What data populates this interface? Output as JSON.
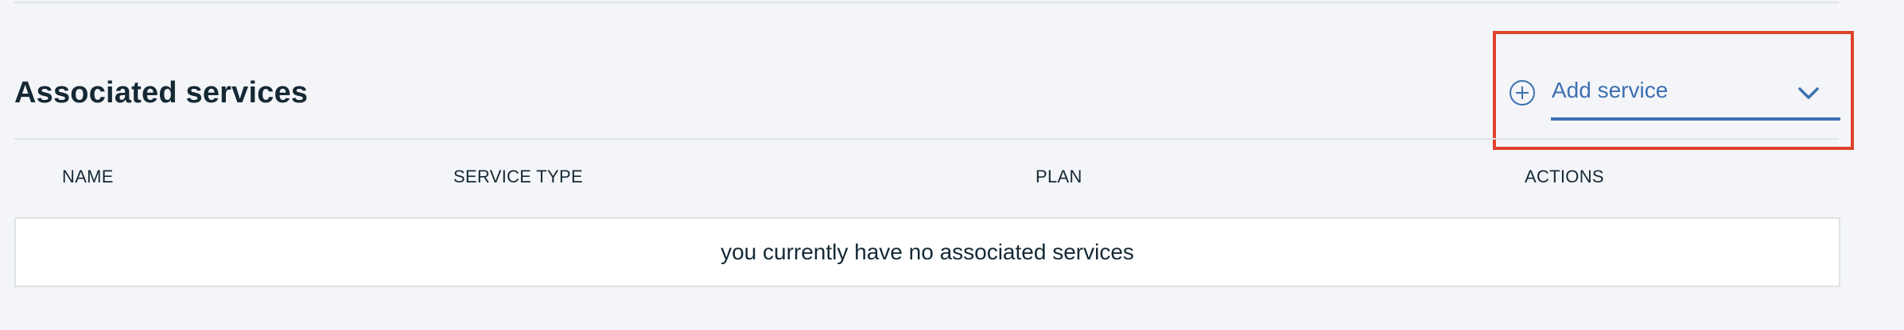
{
  "section": {
    "title": "Associated services"
  },
  "add_service": {
    "label": "Add service",
    "icon": "plus-circle-icon",
    "dropdown_icon": "chevron-down-icon",
    "accent_color": "#3d70b2"
  },
  "highlight": {
    "color": "#e0432b"
  },
  "table": {
    "columns": [
      "NAME",
      "SERVICE TYPE",
      "PLAN",
      "ACTIONS"
    ],
    "empty_message": "you currently have no associated services"
  }
}
